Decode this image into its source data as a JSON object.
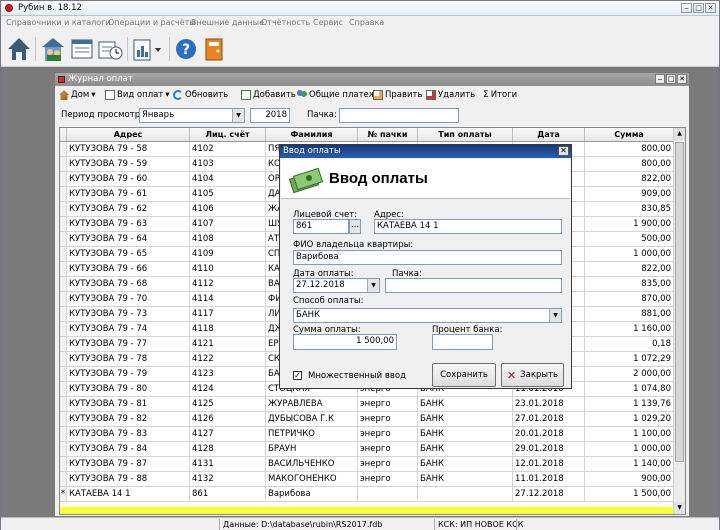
{
  "app": {
    "title": "Рубин в. 18.12"
  },
  "menu": [
    "Справочники и каталоги",
    "Операции и расчёты",
    "Внешние данные",
    "Отчётность",
    "Сервис",
    "Справка"
  ],
  "child": {
    "title": "Журнал оплат",
    "toolbar": {
      "home": "Дом",
      "payment_type": "Вид оплат",
      "refresh": "Обновить",
      "add": "Добавить",
      "common": "Общие платежи",
      "edit": "Править",
      "delete": "Удалить",
      "totals": "Итоги"
    },
    "filter": {
      "period_label": "Период просмотра:",
      "month": "Январь",
      "year": "2018",
      "pack_label": "Пачка:",
      "pack_value": ""
    }
  },
  "table": {
    "columns": [
      "Адрес",
      "Лиц. счёт",
      "Фамилия",
      "№ пачки",
      "Тип оплаты",
      "Дата",
      "Сумма"
    ],
    "rows": [
      {
        "marker": "",
        "address": "КУТУЗОВА 79 - 58",
        "account": "4102",
        "name": "ПЯ",
        "pack": "",
        "type": "",
        "date": "",
        "sum": "800,00"
      },
      {
        "marker": "",
        "address": "КУТУЗОВА 79 - 59",
        "account": "4103",
        "name": "КО",
        "pack": "",
        "type": "",
        "date": "",
        "sum": "800,00"
      },
      {
        "marker": "",
        "address": "КУТУЗОВА 79 - 60",
        "account": "4104",
        "name": "ОР",
        "pack": "",
        "type": "",
        "date": "",
        "sum": "822,00"
      },
      {
        "marker": "",
        "address": "КУТУЗОВА 79 - 61",
        "account": "4105",
        "name": "ДА",
        "pack": "",
        "type": "",
        "date": "",
        "sum": "909,00"
      },
      {
        "marker": "",
        "address": "КУТУЗОВА 79 - 62",
        "account": "4106",
        "name": "ЖА",
        "pack": "",
        "type": "",
        "date": "",
        "sum": "830,85"
      },
      {
        "marker": "",
        "address": "КУТУЗОВА 79 - 63",
        "account": "4107",
        "name": "ШУ",
        "pack": "",
        "type": "",
        "date": "",
        "sum": "1 900,00"
      },
      {
        "marker": "",
        "address": "КУТУЗОВА 79 - 64",
        "account": "4108",
        "name": "АТ",
        "pack": "",
        "type": "",
        "date": "",
        "sum": "500,00"
      },
      {
        "marker": "",
        "address": "КУТУЗОВА 79 - 65",
        "account": "4109",
        "name": "СП",
        "pack": "",
        "type": "",
        "date": "",
        "sum": "1 000,00"
      },
      {
        "marker": "",
        "address": "КУТУЗОВА 79 - 66",
        "account": "4110",
        "name": "КА",
        "pack": "",
        "type": "",
        "date": "",
        "sum": "822,00"
      },
      {
        "marker": "",
        "address": "КУТУЗОВА 79 - 68",
        "account": "4112",
        "name": "ВА",
        "pack": "",
        "type": "",
        "date": "",
        "sum": "835,00"
      },
      {
        "marker": "",
        "address": "КУТУЗОВА 79 - 70",
        "account": "4114",
        "name": "ФИ",
        "pack": "",
        "type": "",
        "date": "",
        "sum": "870,00"
      },
      {
        "marker": "",
        "address": "КУТУЗОВА 79 - 73",
        "account": "4117",
        "name": "ЛИ",
        "pack": "",
        "type": "",
        "date": "",
        "sum": "881,00"
      },
      {
        "marker": "",
        "address": "КУТУЗОВА 79 - 74",
        "account": "4118",
        "name": "ДЖ",
        "pack": "",
        "type": "",
        "date": "",
        "sum": "1 160,00"
      },
      {
        "marker": "",
        "address": "КУТУЗОВА 79 - 77",
        "account": "4121",
        "name": "ЕР",
        "pack": "",
        "type": "",
        "date": "",
        "sum": "0,18"
      },
      {
        "marker": "",
        "address": "КУТУЗОВА 79 - 78",
        "account": "4122",
        "name": "СК",
        "pack": "",
        "type": "",
        "date": "",
        "sum": "1 072,29"
      },
      {
        "marker": "",
        "address": "КУТУЗОВА 79 - 79",
        "account": "4123",
        "name": "БА",
        "pack": "",
        "type": "",
        "date": "",
        "sum": "2 000,00"
      },
      {
        "marker": "",
        "address": "КУТУЗОВА 79 - 80",
        "account": "4124",
        "name": "СТОЦКАЯ",
        "pack": "энерго",
        "type": "БАНК",
        "date": "11.01.2018",
        "sum": "1 074,80"
      },
      {
        "marker": "",
        "address": "КУТУЗОВА 79 - 81",
        "account": "4125",
        "name": "ЖУРАВЛЕВА",
        "pack": "энерго",
        "type": "БАНК",
        "date": "23.01.2018",
        "sum": "1 139,76"
      },
      {
        "marker": "",
        "address": "КУТУЗОВА 79 - 82",
        "account": "4126",
        "name": "ДУБЫСОВА Г.К",
        "pack": "энерго",
        "type": "БАНК",
        "date": "27.01.2018",
        "sum": "1 029,20"
      },
      {
        "marker": "",
        "address": "КУТУЗОВА 79 - 83",
        "account": "4127",
        "name": "ПЕТРИЧКО",
        "pack": "энерго",
        "type": "БАНК",
        "date": "20.01.2018",
        "sum": "1 100,00"
      },
      {
        "marker": "",
        "address": "КУТУЗОВА 79 - 84",
        "account": "4128",
        "name": "БРАУН",
        "pack": "энерго",
        "type": "БАНК",
        "date": "29.01.2018",
        "sum": "1 000,00"
      },
      {
        "marker": "",
        "address": "КУТУЗОВА 79 - 87",
        "account": "4131",
        "name": "ВАСИЛЬЧЕНКО",
        "pack": "энерго",
        "type": "БАНК",
        "date": "12.01.2018",
        "sum": "1 140,00"
      },
      {
        "marker": "",
        "address": "КУТУЗОВА 79 - 88",
        "account": "4132",
        "name": "МАКОГОНЕНКО",
        "pack": "энерго",
        "type": "БАНК",
        "date": "11.01.2018",
        "sum": "900,00"
      },
      {
        "marker": "*",
        "address": "КАТАЕВА 14 1",
        "account": "861",
        "name": "Варибова",
        "pack": "",
        "type": "",
        "date": "27.12.2018",
        "sum": "1 500,00"
      }
    ]
  },
  "dialog": {
    "title": "Ввод оплаты",
    "heading": "Ввод оплаты",
    "account_label": "Лицевой счет:",
    "account_value": "861",
    "browse": "...",
    "address_label": "Адрес:",
    "address_value": "КАТАЕВА 14 1",
    "owner_label": "ФИО владельца квартиры:",
    "owner_value": "Варибова",
    "date_label": "Дата оплаты:",
    "date_value": "27.12.2018",
    "pack_label": "Пачка:",
    "pack_value": "",
    "method_label": "Способ оплаты:",
    "method_value": "БАНК",
    "sum_label": "Сумма оплаты:",
    "sum_value": "1 500,00",
    "percent_label": "Процент банка:",
    "percent_value": "",
    "multi_label": "Множественный ввод",
    "multi_check": "✓",
    "save": "Сохранить",
    "close": "Закрыть"
  },
  "status": {
    "db": "Данные: D:\\database\\rubin\\RS2017.fdb",
    "ksk": "КСК: ИП НОВОЕ КСК"
  }
}
